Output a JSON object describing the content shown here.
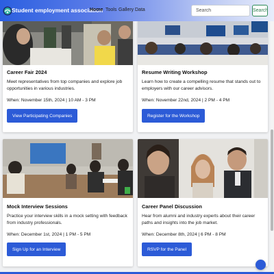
{
  "nav": {
    "brand": "Student employment association",
    "links": [
      "Home",
      "Tools",
      "Gallery",
      "Data"
    ],
    "active": "Home",
    "search_placeholder": "Search",
    "search_button": "Search"
  },
  "cards": [
    {
      "title": "Career Fair 2024",
      "description": "Meet representatives from top companies and explore job opportunities in various industries.",
      "date": "When: November 15th, 2024 | 10 AM - 3 PM",
      "button": "View Participating Companies"
    },
    {
      "title": "Resume Writing Workshop",
      "description": "Learn how to create a compelling resume that stands out to employers with our career advisors.",
      "date": "When: November 22nd, 2024 | 2 PM - 4 PM",
      "button": "Register for the Workshop"
    },
    {
      "title": "Mock Interview Sessions",
      "description": "Practice your interview skills in a mock setting with feedback from industry professionals.",
      "date": "When: December 1st, 2024 | 1 PM - 5 PM",
      "button": "Sign Up for an Interview"
    },
    {
      "title": "Career Panel Discussion",
      "description": "Hear from alumni and industry experts about their career paths and insights into the job market.",
      "date": "When: December 8th, 2024 | 6 PM - 8 PM",
      "button": "RSVP for the Panel"
    }
  ],
  "colors": {
    "primary_button": "#2c5bd7",
    "navbar_start": "#2b5fe0",
    "navbar_end": "#e8edfb",
    "search_button_border": "#2e8b57"
  }
}
